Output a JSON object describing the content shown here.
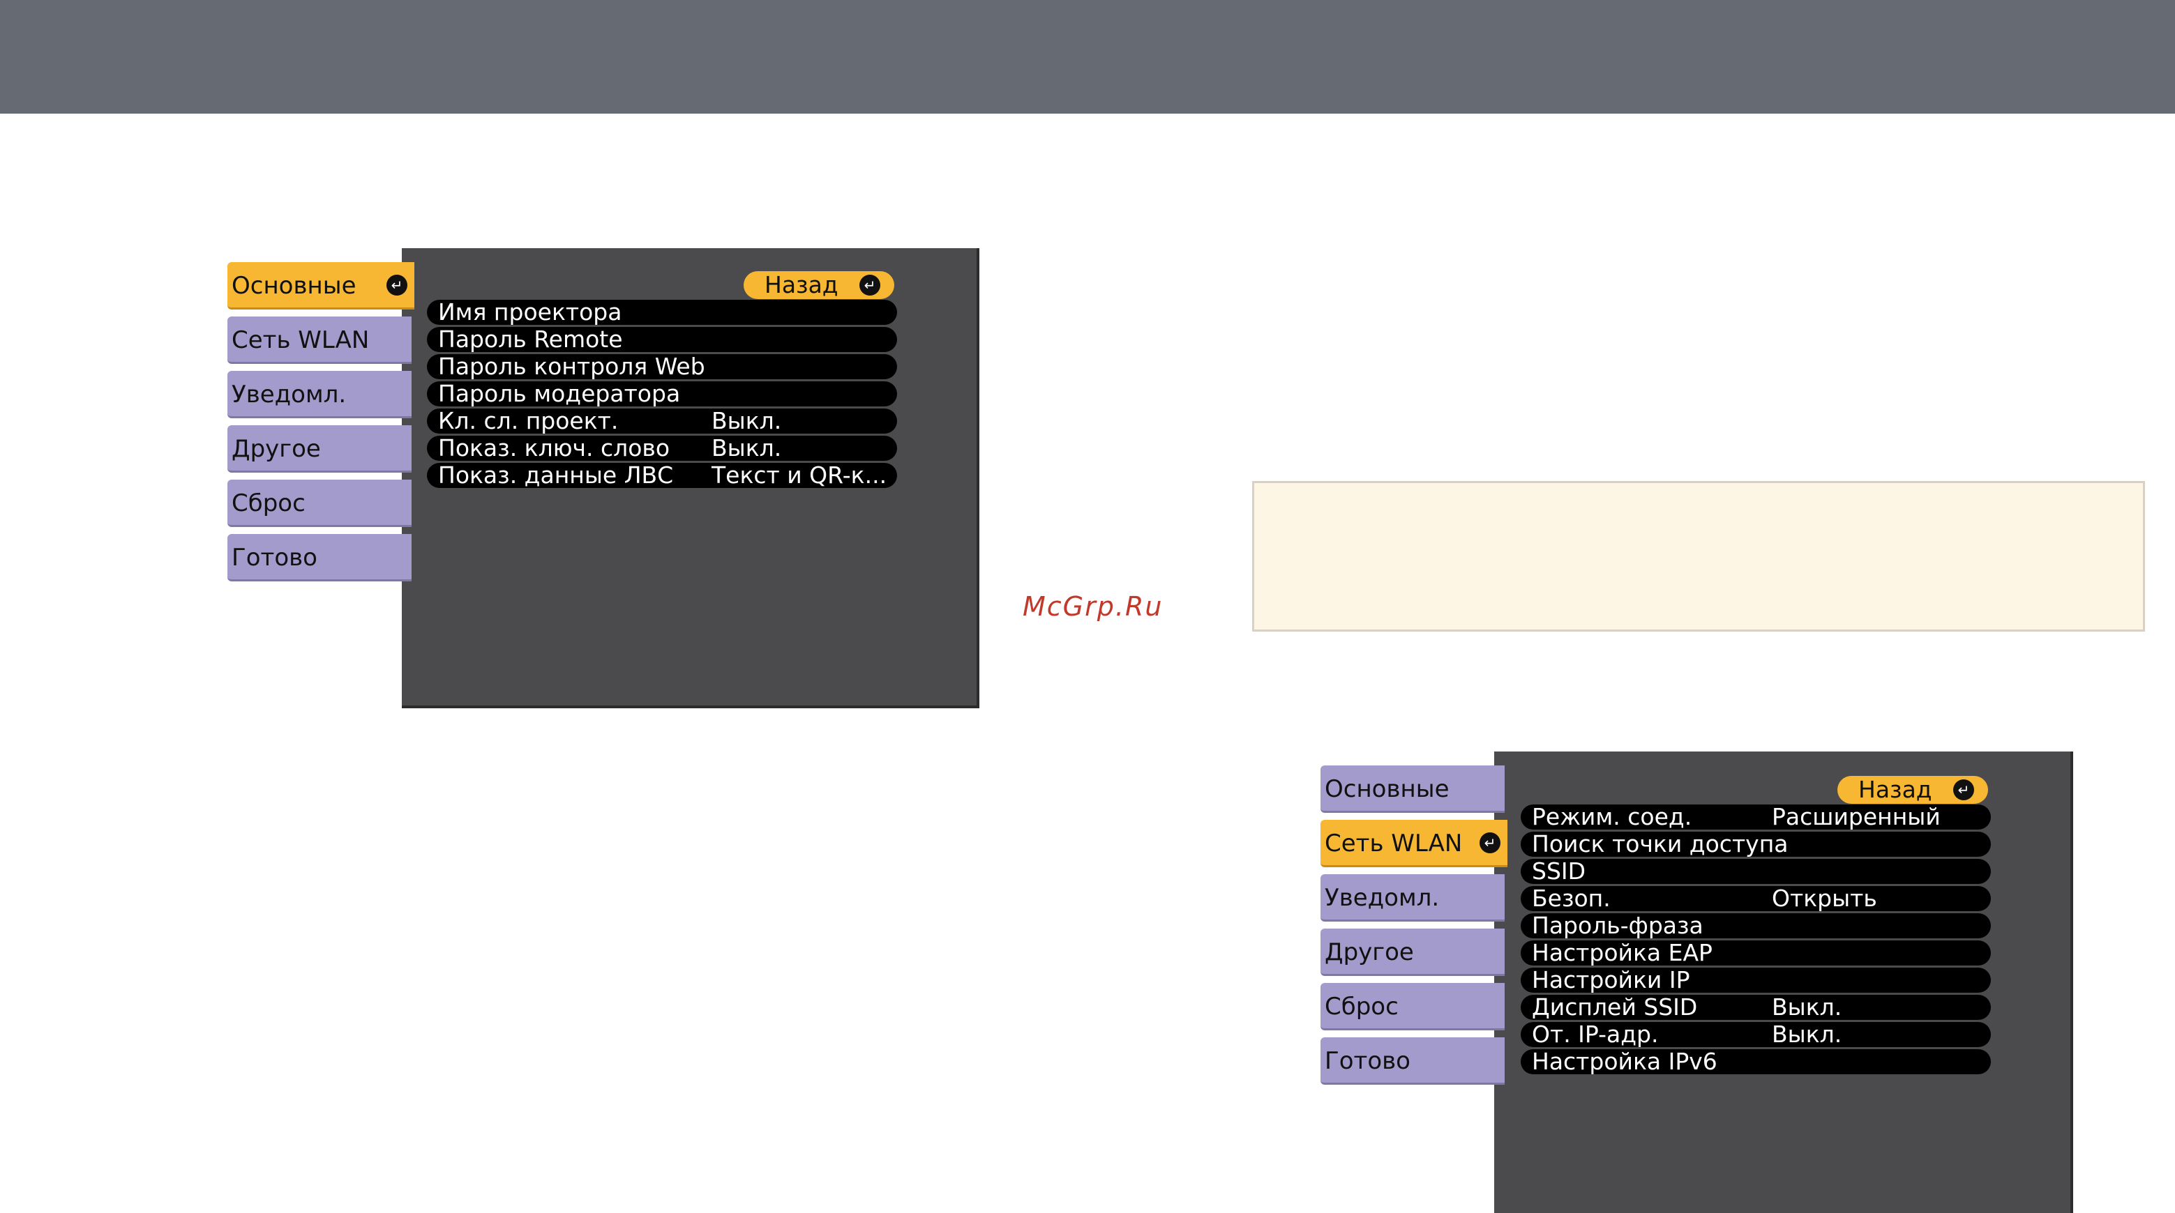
{
  "watermark": "McGrp.Ru",
  "menu1": {
    "tabs": [
      "Основные",
      "Сеть WLAN",
      "Уведомл.",
      "Другое",
      "Сброс",
      "Готово"
    ],
    "active_tab": 0,
    "back_label": "Назад",
    "rows": [
      {
        "label": "Имя проектора",
        "value": ""
      },
      {
        "label": "Пароль Remote",
        "value": ""
      },
      {
        "label": "Пароль контроля Web",
        "value": ""
      },
      {
        "label": "Пароль модератора",
        "value": ""
      },
      {
        "label": "Кл. сл. проект.",
        "value": "Выкл."
      },
      {
        "label": "Показ. ключ. слово",
        "value": "Выкл."
      },
      {
        "label": "Показ. данные ЛВС",
        "value": "Текст и QR-к..."
      }
    ]
  },
  "menu2": {
    "tabs": [
      "Основные",
      "Сеть WLAN",
      "Уведомл.",
      "Другое",
      "Сброс",
      "Готово"
    ],
    "active_tab": 1,
    "back_label": "Назад",
    "rows": [
      {
        "label": "Режим. соед.",
        "value": "Расширенный"
      },
      {
        "label": "Поиск точки доступа",
        "value": ""
      },
      {
        "label": "SSID",
        "value": ""
      },
      {
        "label": "Безоп.",
        "value": "Открыть"
      },
      {
        "label": "Пароль-фраза",
        "value": ""
      },
      {
        "label": "Настройка EAP",
        "value": ""
      },
      {
        "label": "Настройки IP",
        "value": ""
      },
      {
        "label": "Дисплей SSID",
        "value": "Выкл."
      },
      {
        "label": "От. IP-адр.",
        "value": "Выкл."
      },
      {
        "label": "Настройка IPv6",
        "value": ""
      }
    ]
  },
  "icons": {
    "enter": "enter-icon",
    "enter_glyph": "↵"
  }
}
